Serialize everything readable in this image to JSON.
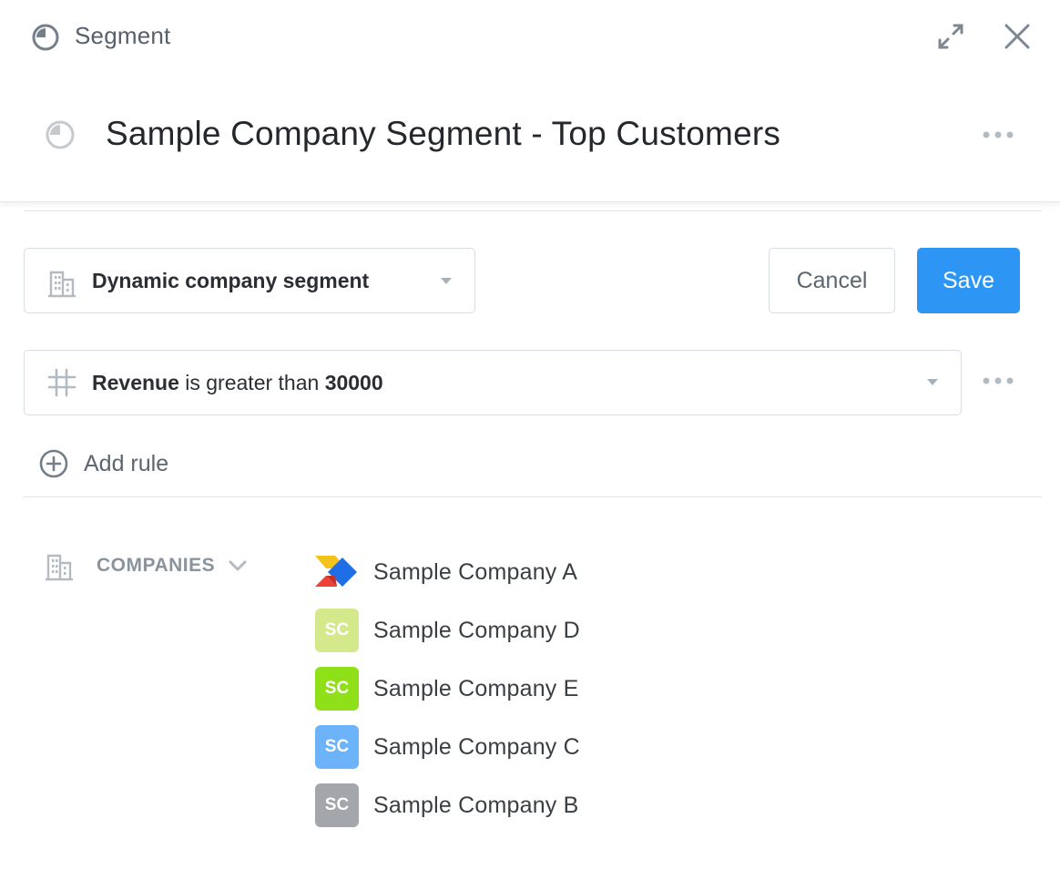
{
  "topbar": {
    "title": "Segment",
    "icons": {
      "segment": "segment-pie-icon",
      "expand": "expand-icon",
      "close": "close-icon"
    }
  },
  "header": {
    "title": "Sample Company Segment - Top Customers",
    "icons": {
      "segment": "segment-pie-icon",
      "more": "more-horizontal-icon"
    }
  },
  "segment_type": {
    "label": "Dynamic company segment",
    "icon": "building-icon"
  },
  "actions": {
    "cancel_label": "Cancel",
    "save_label": "Save"
  },
  "rule": {
    "field": "Revenue",
    "operator": " is greater than ",
    "value": "30000",
    "icon": "hash-icon"
  },
  "add_rule": {
    "label": "Add rule",
    "icon": "plus-circle-icon"
  },
  "companies": {
    "label": "COMPANIES",
    "icon": "building-icon",
    "items": [
      {
        "name": "Sample Company A",
        "avatar_text": "",
        "avatar_type": "logo"
      },
      {
        "name": "Sample Company D",
        "avatar_text": "SC",
        "avatar_color": "#d4e98b"
      },
      {
        "name": "Sample Company E",
        "avatar_text": "SC",
        "avatar_color": "#8fe019"
      },
      {
        "name": "Sample Company C",
        "avatar_text": "SC",
        "avatar_color": "#6cb3f9"
      },
      {
        "name": "Sample Company B",
        "avatar_text": "SC",
        "avatar_color": "#a3a6ab"
      }
    ]
  },
  "colors": {
    "primary": "#2d96f5",
    "border": "#d7dde2",
    "muted_text": "#5b6670"
  }
}
